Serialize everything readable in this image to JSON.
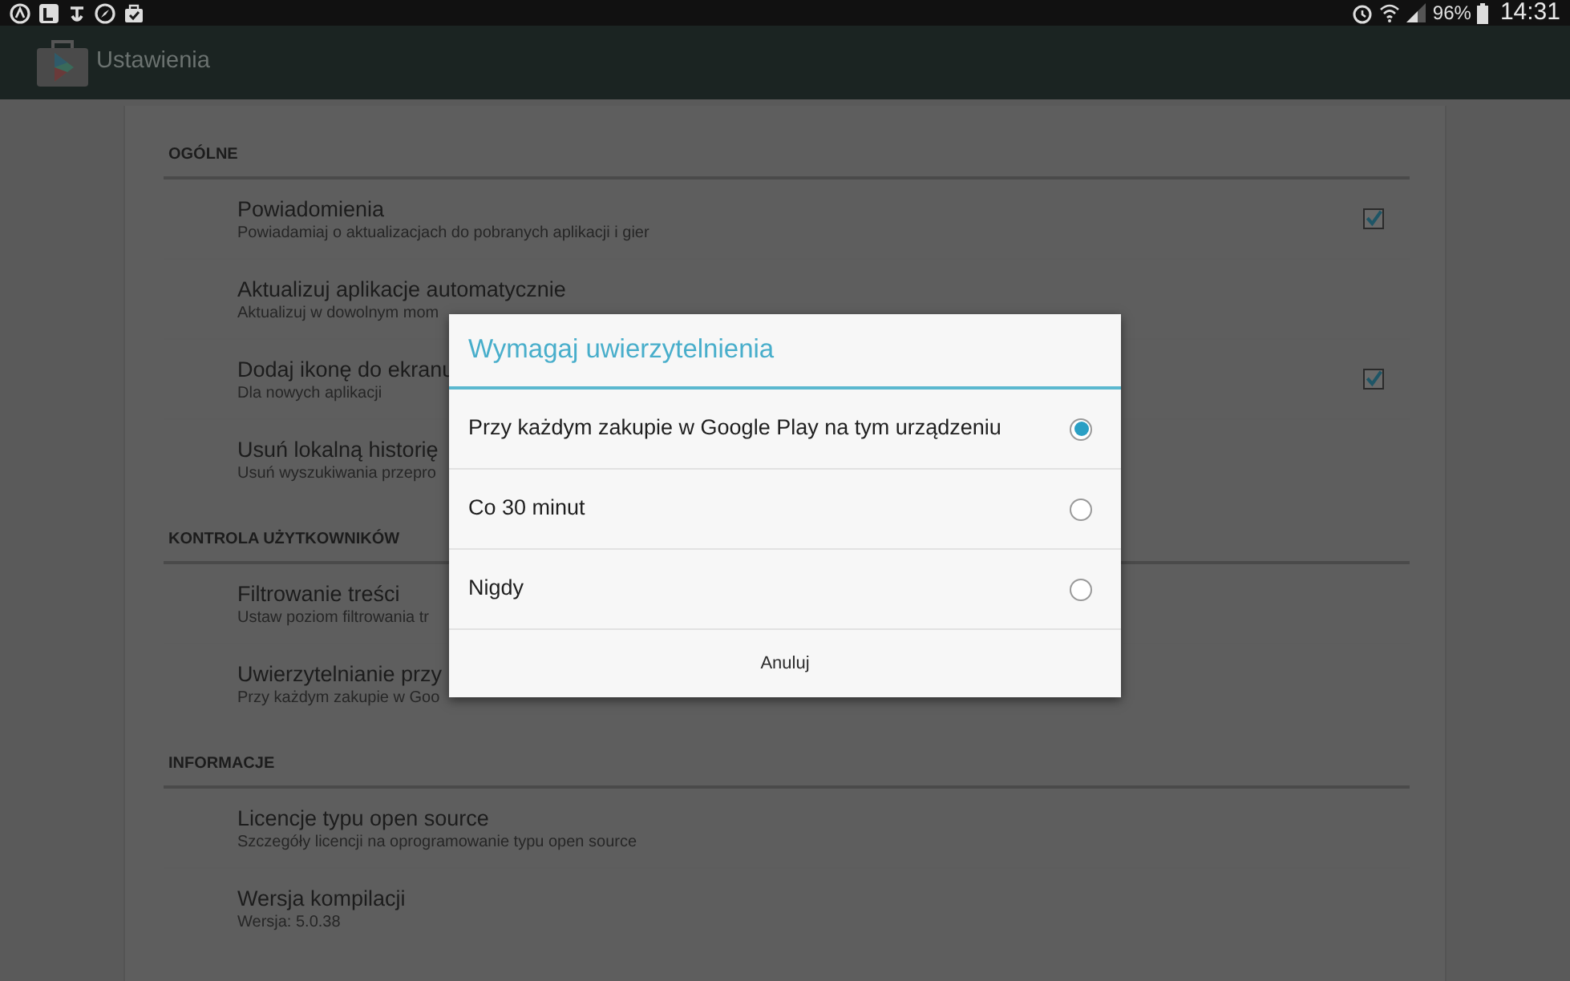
{
  "status_bar": {
    "battery": "96%",
    "time": "14:31"
  },
  "app_bar": {
    "title": "Ustawienia"
  },
  "sections": [
    {
      "header": "OGÓLNE",
      "items": [
        {
          "kind": "checkbox",
          "title": "Powiadomienia",
          "subtitle": "Powiadamiaj o aktualizacjach do pobranych aplikacji i gier",
          "checked": true
        },
        {
          "kind": "plain",
          "title": "Aktualizuj aplikacje automatycznie",
          "subtitle": "Aktualizuj w dowolnym mom"
        },
        {
          "kind": "checkbox",
          "title": "Dodaj ikonę do ekranu",
          "subtitle": "Dla nowych aplikacji",
          "checked": true
        },
        {
          "kind": "plain",
          "title": "Usuń lokalną historię",
          "subtitle": "Usuń wyszukiwania przepro"
        }
      ]
    },
    {
      "header": "KONTROLA UŻYTKOWNIKÓW",
      "items": [
        {
          "kind": "plain",
          "title": "Filtrowanie treści",
          "subtitle": "Ustaw poziom filtrowania tr"
        },
        {
          "kind": "plain",
          "title": "Uwierzytelnianie przy",
          "subtitle": "Przy każdym zakupie w Goo"
        }
      ]
    },
    {
      "header": "INFORMACJE",
      "items": [
        {
          "kind": "plain",
          "title": "Licencje typu open source",
          "subtitle": "Szczegóły licencji na oprogramowanie typu open source"
        },
        {
          "kind": "plain",
          "title": "Wersja kompilacji",
          "subtitle": "Wersja: 5.0.38"
        }
      ]
    }
  ],
  "dialog": {
    "title": "Wymagaj uwierzytelnienia",
    "options": [
      {
        "label": "Przy każdym zakupie w Google Play na tym urządzeniu",
        "selected": true
      },
      {
        "label": "Co 30 minut",
        "selected": false
      },
      {
        "label": "Nigdy",
        "selected": false
      }
    ],
    "button": "Anuluj"
  }
}
